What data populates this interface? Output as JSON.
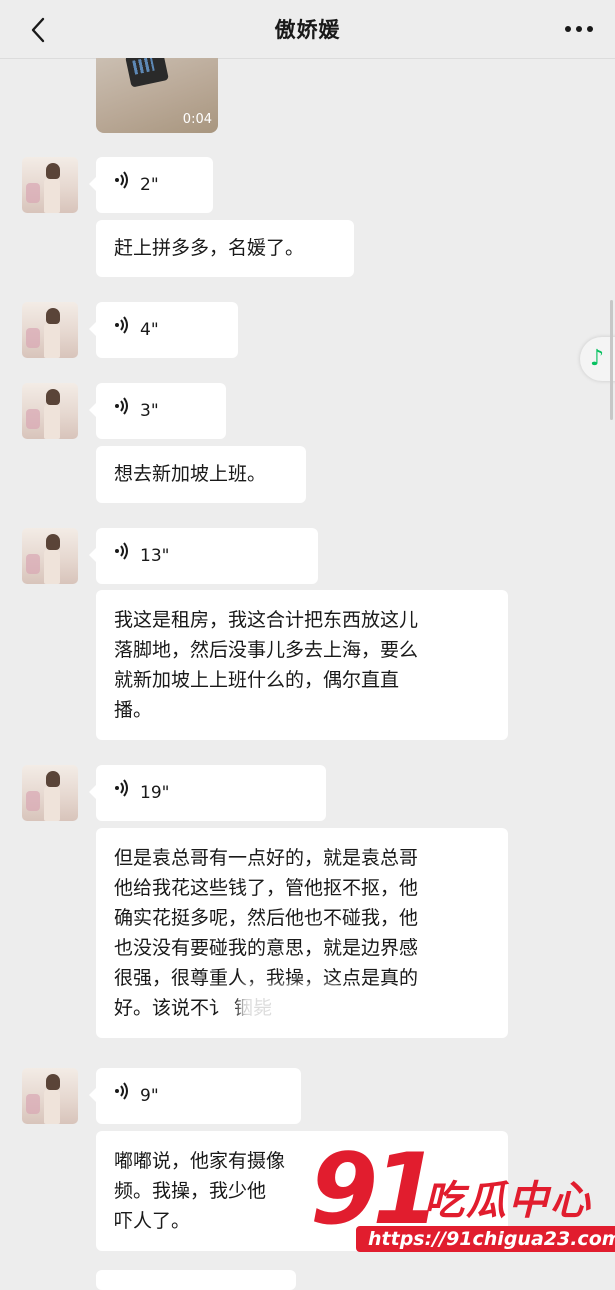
{
  "header": {
    "title": "傲娇媛"
  },
  "video": {
    "duration": "0:04"
  },
  "messages": [
    {
      "type": "voice",
      "duration": "2\""
    },
    {
      "type": "text",
      "lines": [
        "赶上拼多多，名媛了。"
      ]
    },
    {
      "type": "voice",
      "duration": "4\""
    },
    {
      "type": "voice",
      "duration": "3\""
    },
    {
      "type": "text",
      "lines": [
        "想去新加坡上班。"
      ]
    },
    {
      "type": "voice",
      "duration": "13\""
    },
    {
      "type": "text",
      "lines": [
        "我这是租房，我这合计把东西放这儿",
        "落脚地，然后没事儿多去上海，要么",
        "就新加坡上上班什么的，偶尔直直",
        "播。"
      ]
    },
    {
      "type": "voice",
      "duration": "19\""
    },
    {
      "type": "text",
      "lines": [
        "但是袁总哥有一点好的，就是袁总哥",
        "他给我花这些钱了，管他抠不抠，他",
        "确实花挺多呢，然后他也不碰我，他",
        "也没没有要碰我的意思，就是边界感",
        "很强，很尊重人，我操，这点是真的",
        "好。该说不讠               铟毙"
      ]
    },
    {
      "type": "voice",
      "duration": "9\""
    },
    {
      "type": "text",
      "lines": [
        "嘟嘟说，他家有摄像",
        "频。我操，我少他",
        "吓人了。"
      ]
    }
  ],
  "watermark": {
    "logo_number": "91",
    "logo_text": "吃瓜中心",
    "url": "https://91chigua23.com"
  },
  "icons": {
    "back": "chevron-left-icon",
    "more": "more-dots-icon",
    "voice": "voice-wave-icon",
    "music": "music-note-icon"
  },
  "colors": {
    "background": "#ededed",
    "bubble": "#ffffff",
    "music_accent": "#07c160",
    "watermark_red": "#e11d2e"
  }
}
